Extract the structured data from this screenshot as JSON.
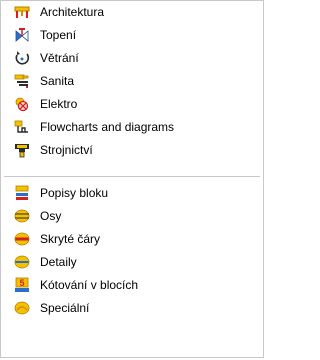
{
  "menu": {
    "group1": [
      {
        "label": "Architektura",
        "icon": "architecture-table-icon"
      },
      {
        "label": "Topení",
        "icon": "heating-valve-icon"
      },
      {
        "label": "Větrání",
        "icon": "ventilation-fan-icon"
      },
      {
        "label": "Sanita",
        "icon": "sanitary-faucet-icon"
      },
      {
        "label": "Elektro",
        "icon": "electric-lamp-icon"
      },
      {
        "label": "Flowcharts and diagrams",
        "icon": "flowchart-icon"
      },
      {
        "label": "Strojnictví",
        "icon": "machinery-icon"
      }
    ],
    "group2": [
      {
        "label": "Popisy bloku",
        "icon": "block-labels-icon"
      },
      {
        "label": "Osy",
        "icon": "axes-icon"
      },
      {
        "label": "Skryté čáry",
        "icon": "hidden-lines-icon"
      },
      {
        "label": "Detaily",
        "icon": "details-icon"
      },
      {
        "label": "Kótování v blocích",
        "icon": "dimensioning-icon"
      },
      {
        "label": "Speciální",
        "icon": "special-icon"
      }
    ]
  },
  "colors": {
    "icon_yellow": "#f2c200",
    "icon_orange": "#d88a00",
    "icon_red": "#d21f1f",
    "icon_blue": "#2d6fc4",
    "icon_dark": "#2b2b2b",
    "border": "#c8c8c8"
  }
}
